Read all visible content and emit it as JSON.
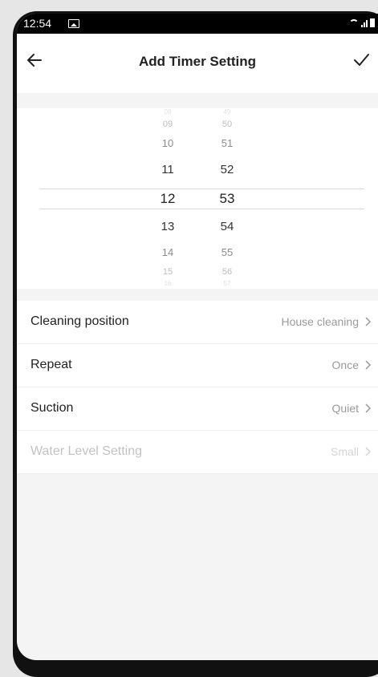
{
  "status": {
    "time": "12:54"
  },
  "header": {
    "title": "Add Timer Setting"
  },
  "picker": {
    "hours": [
      "08",
      "09",
      "10",
      "11",
      "12",
      "13",
      "14",
      "15",
      "16"
    ],
    "minutes": [
      "49",
      "50",
      "51",
      "52",
      "53",
      "54",
      "55",
      "56",
      "57"
    ],
    "selected_hour": "12",
    "selected_minute": "53"
  },
  "settings": [
    {
      "label": "Cleaning position",
      "value": "House cleaning",
      "enabled": true
    },
    {
      "label": "Repeat",
      "value": "Once",
      "enabled": true
    },
    {
      "label": "Suction",
      "value": "Quiet",
      "enabled": true
    },
    {
      "label": "Water Level Setting",
      "value": "Small",
      "enabled": false
    }
  ],
  "colors": {
    "background": "#f4f4f4",
    "surface": "#ffffff",
    "text": "#222222",
    "muted": "#9a9a9a",
    "disabled": "#c2c2c2",
    "statusbar": "#000000"
  },
  "icons": {
    "back": "arrow-left-icon",
    "confirm": "checkmark-icon",
    "chevron": "chevron-right-icon",
    "wifi": "wifi-icon",
    "signal": "signal-icon",
    "battery": "battery-icon",
    "image": "image-notification-icon"
  }
}
